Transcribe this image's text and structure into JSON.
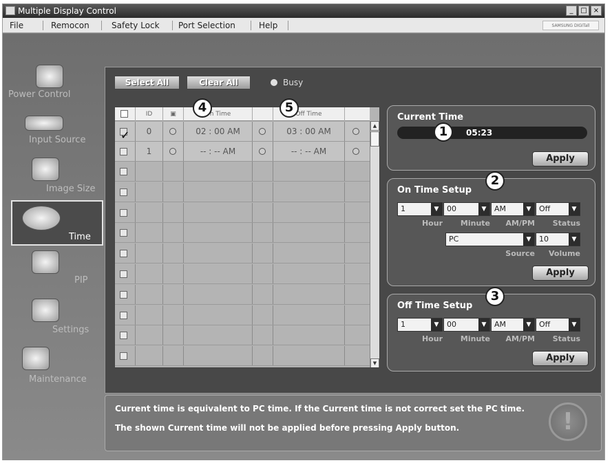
{
  "window": {
    "title": "Multiple Display Control",
    "buttons": [
      "_",
      "□",
      "×"
    ]
  },
  "menu": [
    "File",
    "Remocon",
    "Safety Lock",
    "Port Selection",
    "Help"
  ],
  "brand": "SAMSUNG DIGITall",
  "sidebar": [
    {
      "label": "Power Control",
      "icon": "power-control-icon"
    },
    {
      "label": "Input Source",
      "icon": "input-source-icon"
    },
    {
      "label": "Image Size",
      "icon": "image-size-icon"
    },
    {
      "label": "Time",
      "icon": "clock-icon",
      "active": true
    },
    {
      "label": "PIP",
      "icon": "pip-icon"
    },
    {
      "label": "Settings",
      "icon": "settings-icon"
    },
    {
      "label": "Maintenance",
      "icon": "maintenance-icon"
    }
  ],
  "toolbar": {
    "select_all": "Select All",
    "clear_all": "Clear All",
    "busy": "Busy"
  },
  "table": {
    "headers": {
      "id": "ID",
      "on_time": "On Time",
      "off_time": "Off Time"
    },
    "rows": [
      {
        "checked": true,
        "id": "0",
        "on_time": "02 : 00 AM",
        "off_time": "03 : 00 AM"
      },
      {
        "checked": false,
        "id": "1",
        "on_time": "-- : -- AM",
        "off_time": "-- : -- AM"
      }
    ],
    "empty_rows": 10
  },
  "callouts": [
    "1",
    "2",
    "3",
    "4",
    "5"
  ],
  "current_time": {
    "title": "Current Time",
    "value": "05:23",
    "apply": "Apply"
  },
  "on_time_setup": {
    "title": "On Time Setup",
    "hour": "1",
    "minute": "00",
    "ampm": "AM",
    "status": "Off",
    "source": "PC",
    "volume": "10",
    "labels": {
      "hour": "Hour",
      "minute": "Minute",
      "ampm": "AM/PM",
      "status": "Status",
      "source": "Source",
      "volume": "Volume"
    },
    "apply": "Apply"
  },
  "off_time_setup": {
    "title": "Off Time Setup",
    "hour": "1",
    "minute": "00",
    "ampm": "AM",
    "status": "Off",
    "labels": {
      "hour": "Hour",
      "minute": "Minute",
      "ampm": "AM/PM",
      "status": "Status"
    },
    "apply": "Apply"
  },
  "message": {
    "line1": "Current time is equivalent to PC time. If the Current time is not correct set the PC time.",
    "line2": "The shown Current time will not be applied before pressing Apply button.",
    "icon": "warning-icon"
  }
}
